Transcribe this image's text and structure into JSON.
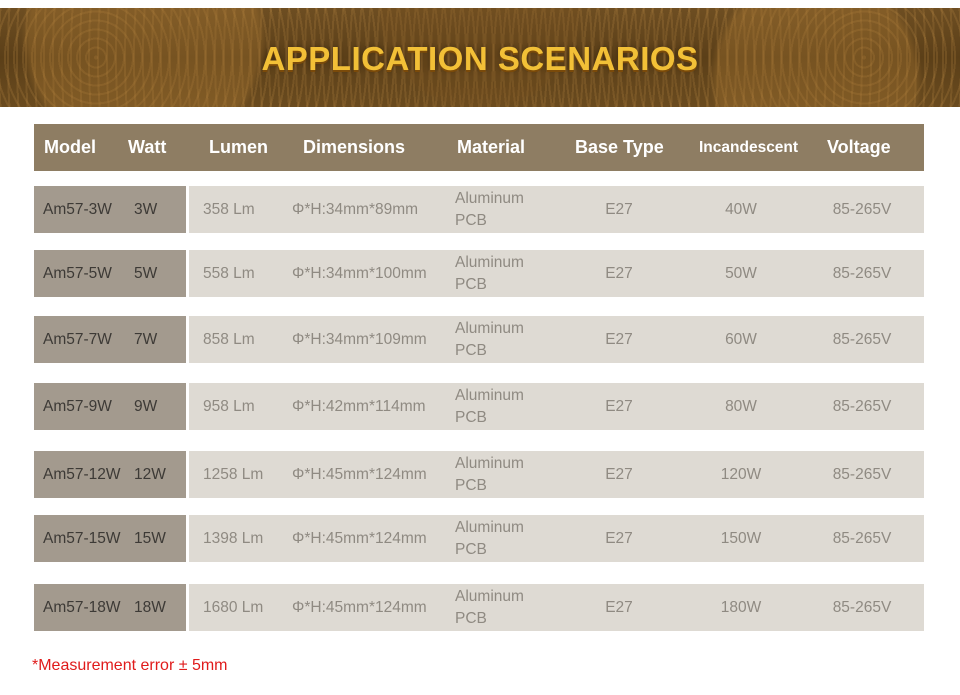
{
  "banner": {
    "title": "APPLICATION SCENARIOS"
  },
  "headers": {
    "model": "Model",
    "watt": "Watt",
    "lumen": "Lumen",
    "dimensions": "Dimensions",
    "material": "Material",
    "base_type": "Base Type",
    "incandescent": "Incandescent",
    "voltage": "Voltage"
  },
  "rows": [
    {
      "model": "Am57-3W",
      "watt": "3W",
      "lumen": "358 Lm",
      "dimensions": "Φ*H:34mm*89mm",
      "material_line1": "Aluminum",
      "material_line2": "PCB",
      "base_type": "E27",
      "incandescent": "40W",
      "voltage": "85-265V"
    },
    {
      "model": "Am57-5W",
      "watt": "5W",
      "lumen": "558 Lm",
      "dimensions": "Φ*H:34mm*100mm",
      "material_line1": "Aluminum",
      "material_line2": "PCB",
      "base_type": "E27",
      "incandescent": "50W",
      "voltage": "85-265V"
    },
    {
      "model": "Am57-7W",
      "watt": "7W",
      "lumen": "858 Lm",
      "dimensions": "Φ*H:34mm*109mm",
      "material_line1": "Aluminum",
      "material_line2": "PCB",
      "base_type": "E27",
      "incandescent": "60W",
      "voltage": "85-265V"
    },
    {
      "model": "Am57-9W",
      "watt": "9W",
      "lumen": "958 Lm",
      "dimensions": "Φ*H:42mm*114mm",
      "material_line1": "Aluminum",
      "material_line2": "PCB",
      "base_type": "E27",
      "incandescent": "80W",
      "voltage": "85-265V"
    },
    {
      "model": "Am57-12W",
      "watt": "12W",
      "lumen": "1258 Lm",
      "dimensions": "Φ*H:45mm*124mm",
      "material_line1": "Aluminum",
      "material_line2": "PCB",
      "base_type": "E27",
      "incandescent": "120W",
      "voltage": "85-265V"
    },
    {
      "model": "Am57-15W",
      "watt": "15W",
      "lumen": "1398 Lm",
      "dimensions": "Φ*H:45mm*124mm",
      "material_line1": "Aluminum",
      "material_line2": "PCB",
      "base_type": "E27",
      "incandescent": "150W",
      "voltage": "85-265V"
    },
    {
      "model": "Am57-18W",
      "watt": "18W",
      "lumen": "1680 Lm",
      "dimensions": "Φ*H:45mm*124mm",
      "material_line1": "Aluminum",
      "material_line2": "PCB",
      "base_type": "E27",
      "incandescent": "180W",
      "voltage": "85-265V"
    }
  ],
  "note": "*Measurement error ± 5mm",
  "colors": {
    "header_bg": "#8e7d63",
    "model_cell_bg": "#a39a8e",
    "row_bg": "#dedad3",
    "note_red": "#e01b1b",
    "title_gold": "#f2c037"
  }
}
